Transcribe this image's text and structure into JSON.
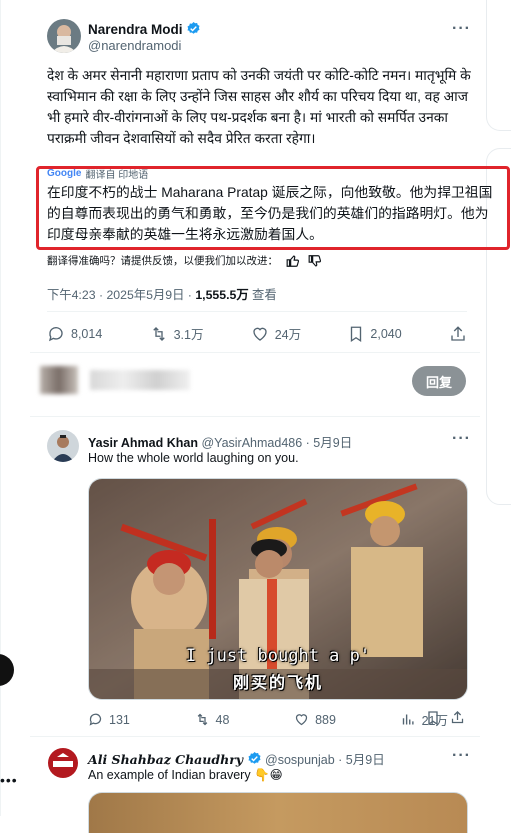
{
  "main_tweet": {
    "author_name": "Narendra Modi",
    "handle": "@narendramodi",
    "text": "देश के अमर सेनानी महाराणा प्रताप को उनकी जयंती पर कोटि-कोटि नमन। मातृभूमि के स्वाभिमान की रक्षा के लिए उन्होंने जिस साहस और शौर्य का परिचय दिया था, वह आज भी हमारे वीर-वीरांगनाओं के लिए पथ-प्रदर्शक बना है। मां भारती को समर्पित उनका पराक्रमी जीवन देशवासियों को सदैव प्रेरित करता रहेगा।",
    "translate_provider": "Google",
    "translate_label": "翻译自 印地语",
    "translation": "在印度不朽的战士 Maharana Pratap 诞辰之际，向他致敬。他为捍卫祖国的自尊而表现出的勇气和勇敢，至今仍是我们的英雄们的指路明灯。他为印度母亲奉献的英雄一生将永远激励着国人。",
    "feedback_prompt": "翻译得准确吗？请提供反馈，以便我们加以改进：",
    "time": "下午4:23 · 2025年5月9日 · ",
    "views_count": "1,555.5万",
    "views_label": " 查看",
    "metrics": {
      "replies": "8,014",
      "reposts": "3.1万",
      "likes": "24万",
      "bookmarks": "2,040"
    }
  },
  "reply_composer": {
    "button_label": "回复"
  },
  "replies": [
    {
      "author_name": "Yasir Ahmad Khan",
      "handle": "@YasirAhmad486",
      "date": " · 5月9日",
      "text": "How the whole world laughing on you.",
      "video_caption_en": "I just bought a p'",
      "video_caption_zh": "刚买的飞机",
      "metrics": {
        "replies": "131",
        "reposts": "48",
        "likes": "889",
        "views": "21万"
      }
    },
    {
      "author_name": "Ali Shahbaz Chaudhry",
      "handle": "@sospunjab",
      "date": " · 5月9日",
      "text": "An example of Indian bravery 👇😁"
    }
  ],
  "colors": {
    "highlight_border": "#e0242b",
    "verified": "#1d9bf0",
    "muted_text": "#536471"
  }
}
